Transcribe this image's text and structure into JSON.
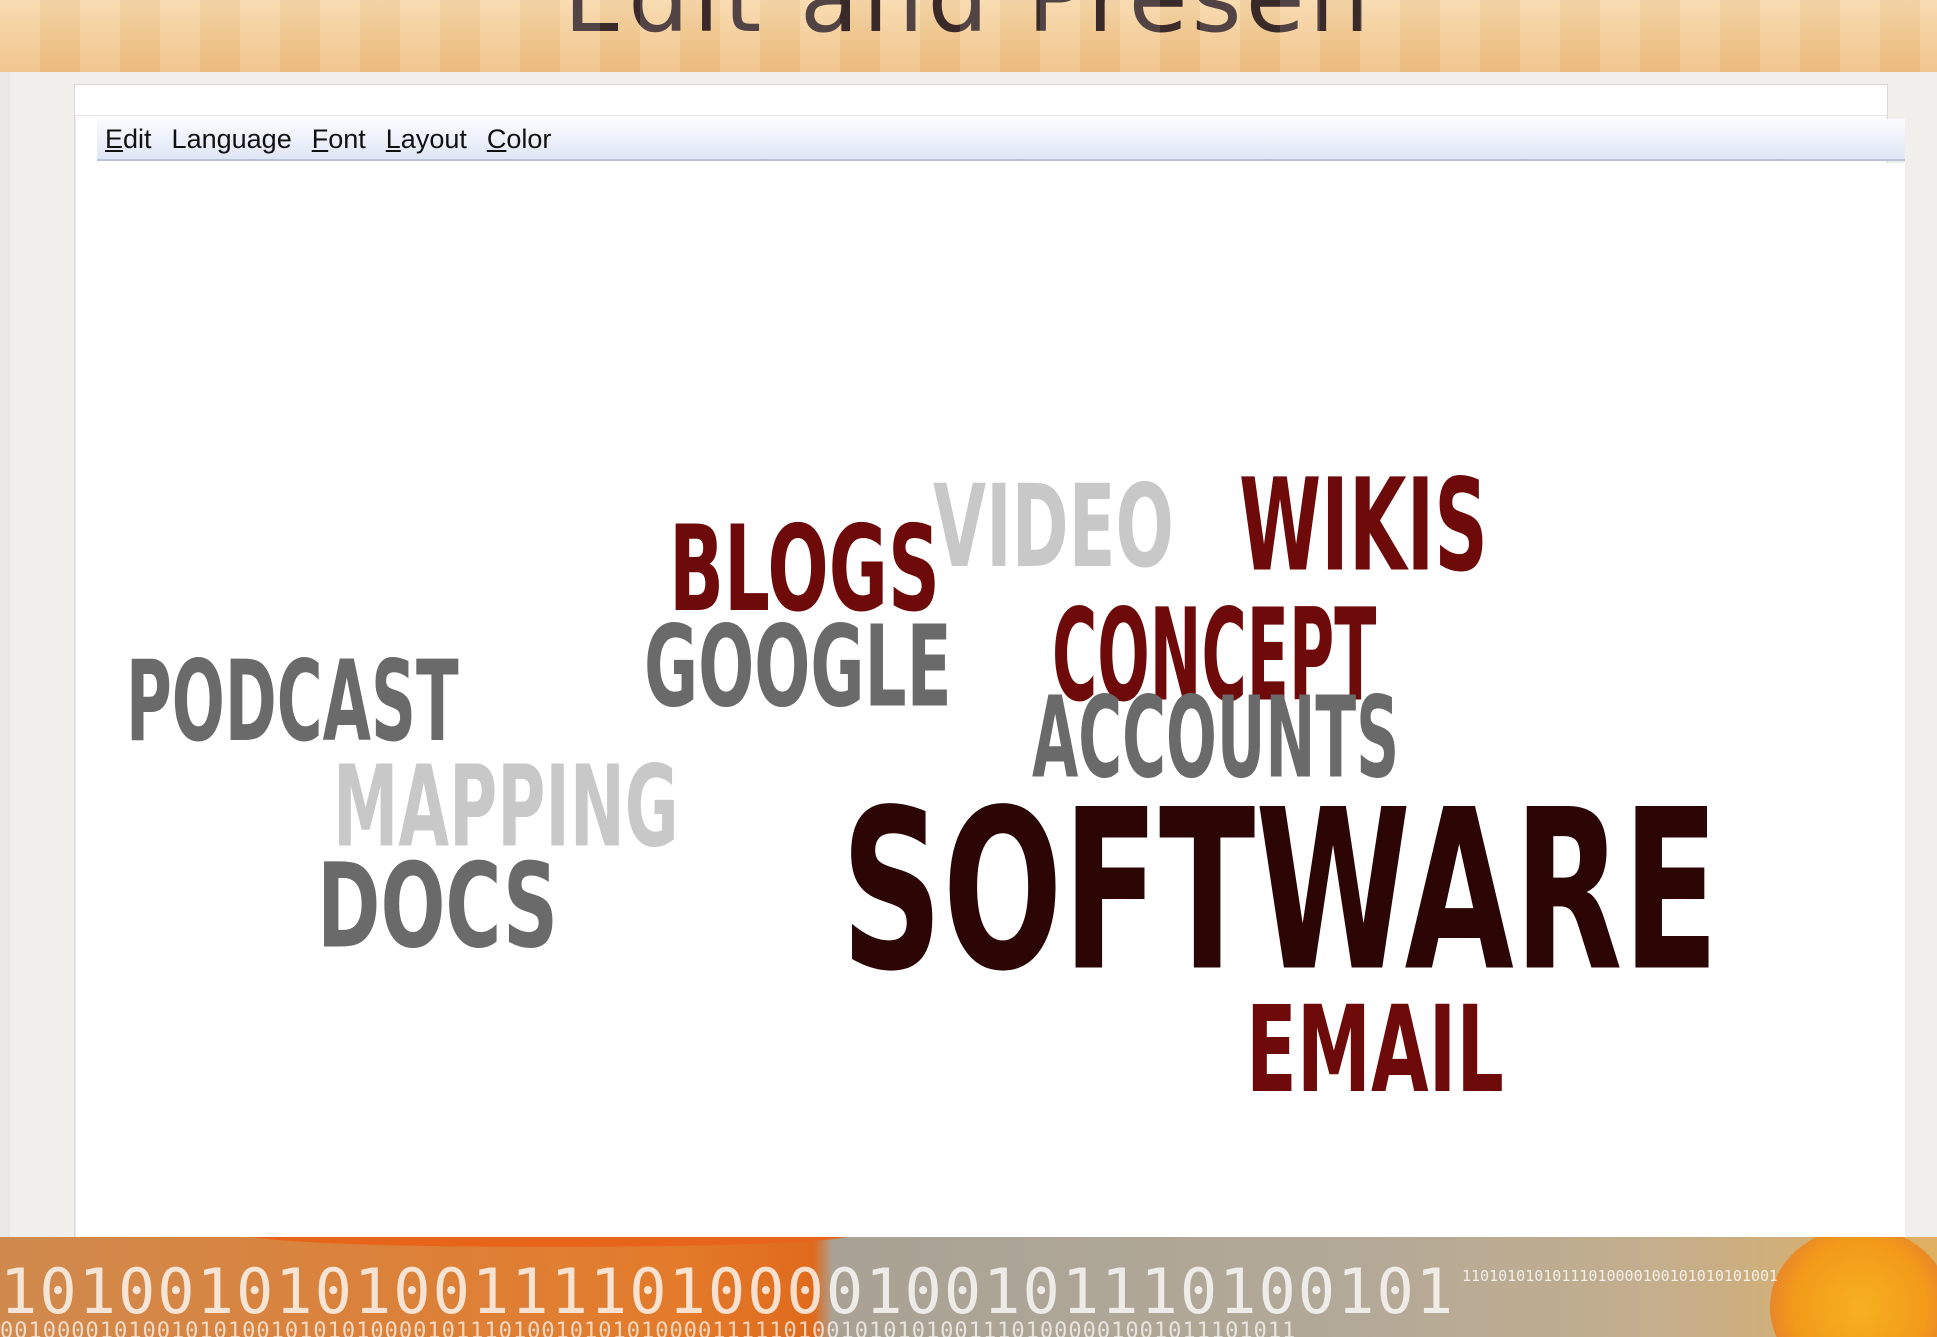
{
  "slide": {
    "title": "Edit and Presen"
  },
  "menubar": {
    "items": [
      {
        "pre": "",
        "acc": "E",
        "post": "dit"
      },
      {
        "pre": "Lan",
        "acc": "g",
        "post": "uage"
      },
      {
        "pre": "",
        "acc": "F",
        "post": "ont"
      },
      {
        "pre": "",
        "acc": "L",
        "post": "ayout"
      },
      {
        "pre": "",
        "acc": "C",
        "post": "olor"
      }
    ]
  },
  "word_cloud": {
    "colors": {
      "dark_red": "#6e0a0a",
      "near_black": "#2c0505",
      "mid_gray": "#6a6a6a",
      "light_gray": "#c8c8c8"
    },
    "words": [
      {
        "text": "BLOGS",
        "color": "#6e0a0a"
      },
      {
        "text": "VIDEO",
        "color": "#c8c8c8"
      },
      {
        "text": "WIKIS",
        "color": "#6e0a0a"
      },
      {
        "text": "GOOGLE",
        "color": "#6a6a6a"
      },
      {
        "text": "CONCEPT",
        "color": "#6e0a0a"
      },
      {
        "text": "PODCAST",
        "color": "#6a6a6a"
      },
      {
        "text": "ACCOUNTS",
        "color": "#6a6a6a"
      },
      {
        "text": "MAPPING",
        "color": "#c8c8c8"
      },
      {
        "text": "SOFTWARE",
        "color": "#2c0505"
      },
      {
        "text": "DOCS",
        "color": "#6a6a6a"
      },
      {
        "text": "EMAIL",
        "color": "#6e0a0a"
      }
    ]
  },
  "banner": {
    "binary_big": "1010010101001111010000100101110100101",
    "binary_small": "11010101010111010000100101010101001",
    "binary_line2": "0010000101001010100101010100001011101001010101000011111010010101010011101000001001011101011"
  }
}
